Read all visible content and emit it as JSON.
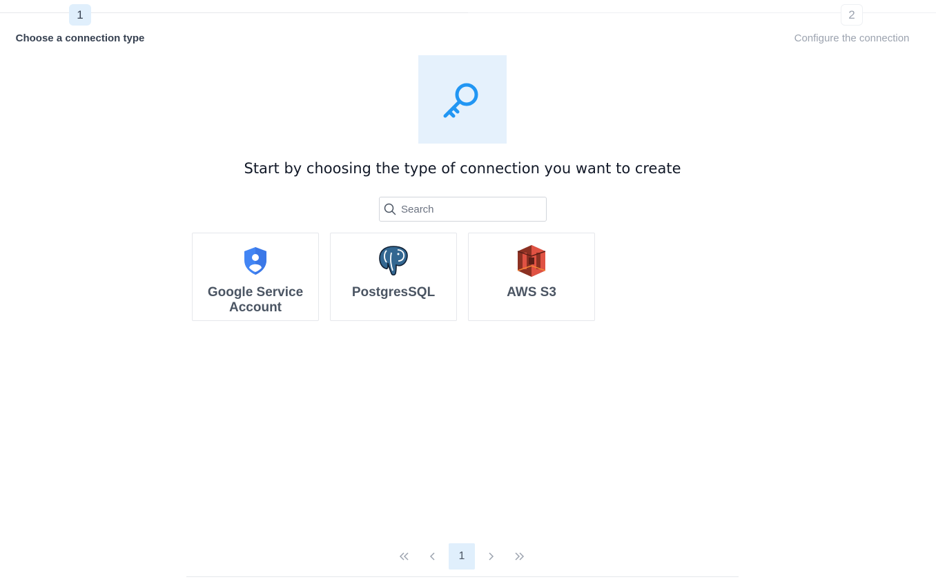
{
  "stepper": {
    "steps": [
      {
        "number": "1",
        "label": "Choose a connection type",
        "state": "active"
      },
      {
        "number": "2",
        "label": "Configure the connection",
        "state": "inactive"
      }
    ]
  },
  "hero": {
    "icon": "key-icon",
    "title": "Start by choosing the type of connection you want to create"
  },
  "search": {
    "placeholder": "Search",
    "value": ""
  },
  "connection_types": [
    {
      "label": "Google Service Account",
      "icon": "google-service-account-icon",
      "color": "#4285f4"
    },
    {
      "label": "PostgresSQL",
      "icon": "postgresql-elephant-icon",
      "color": "#336791"
    },
    {
      "label": "AWS S3",
      "icon": "aws-s3-icon",
      "color": "#e05243"
    }
  ],
  "pagination": {
    "current_page": "1",
    "controls": [
      "first-page",
      "previous-page",
      "next-page",
      "last-page"
    ]
  },
  "colors": {
    "accent": "#2196f3",
    "active_step_bg": "#e0effc",
    "hero_bg": "#e5f1fc"
  }
}
